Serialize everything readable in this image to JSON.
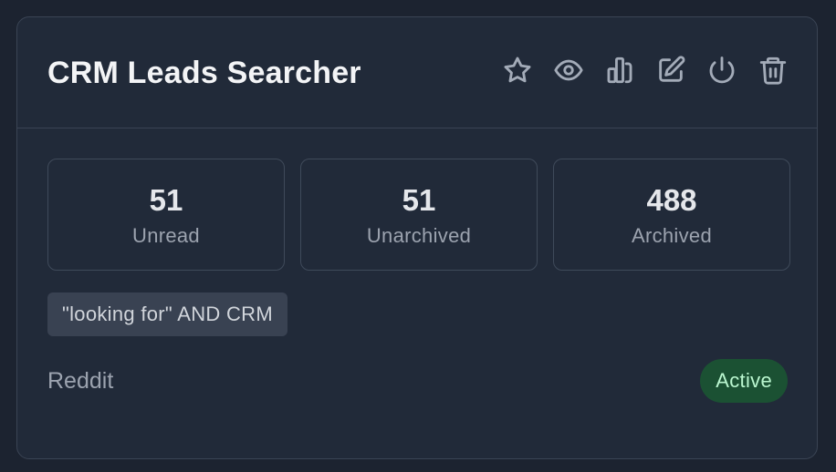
{
  "card": {
    "title": "CRM Leads Searcher",
    "toolbar": [
      {
        "name": "star-button",
        "icon": "star-icon"
      },
      {
        "name": "view-button",
        "icon": "eye-icon"
      },
      {
        "name": "stats-button",
        "icon": "chart-icon"
      },
      {
        "name": "edit-button",
        "icon": "edit-icon"
      },
      {
        "name": "power-button",
        "icon": "power-icon"
      },
      {
        "name": "delete-button",
        "icon": "trash-icon"
      }
    ],
    "stats": [
      {
        "value": "51",
        "label": "Unread"
      },
      {
        "value": "51",
        "label": "Unarchived"
      },
      {
        "value": "488",
        "label": "Archived"
      }
    ],
    "query": "\"looking for\" AND CRM",
    "source": "Reddit",
    "status": "Active"
  },
  "colors": {
    "page_background": "#1c2330",
    "card_background": "#212a39",
    "border": "#3a4454",
    "status_active_bg": "#1b5133",
    "status_active_text": "#bbf7d0"
  }
}
